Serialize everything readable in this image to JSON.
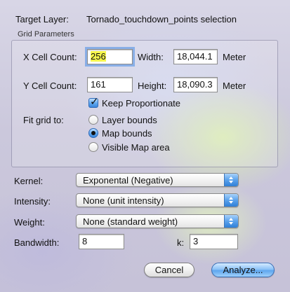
{
  "header": {
    "target_layer_label": "Target Layer:",
    "target_layer_value": "Tornado_touchdown_points selection"
  },
  "grid": {
    "title": "Grid Parameters",
    "x_cell_label": "X Cell Count:",
    "x_cell_value": "256",
    "width_label": "Width:",
    "width_value": "18,044.1",
    "width_unit": "Meter",
    "y_cell_label": "Y Cell Count:",
    "y_cell_value": "161",
    "height_label": "Height:",
    "height_value": "18,090.3",
    "height_unit": "Meter",
    "keep_proportionate_label": "Keep Proportionate",
    "keep_proportionate_checked": true,
    "fit_label": "Fit grid to:",
    "fit_options": [
      "Layer bounds",
      "Map bounds",
      "Visible Map area"
    ],
    "fit_selected": "Map bounds"
  },
  "settings": {
    "kernel_label": "Kernel:",
    "kernel_value": "Exponental (Negative)",
    "intensity_label": "Intensity:",
    "intensity_value": "None (unit intensity)",
    "weight_label": "Weight:",
    "weight_value": "None (standard weight)",
    "bandwidth_label": "Bandwidth:",
    "bandwidth_value": "8",
    "k_label": "k:",
    "k_value": "3"
  },
  "buttons": {
    "cancel": "Cancel",
    "analyze": "Analyze..."
  },
  "colors": {
    "accent": "#5ea6ee",
    "selection_highlight": "#f6f64c"
  }
}
